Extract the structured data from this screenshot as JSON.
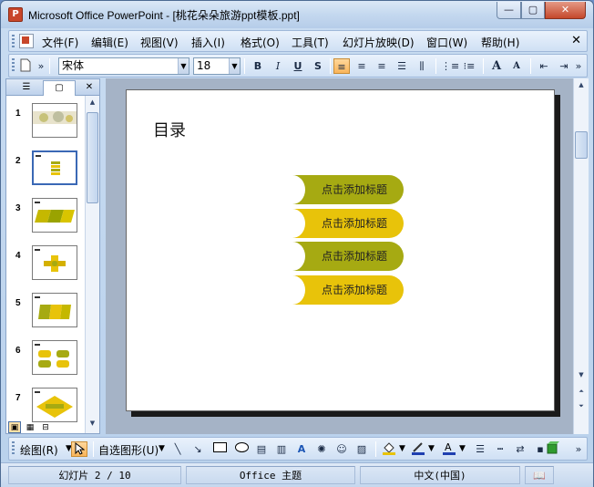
{
  "window": {
    "title": "Microsoft Office PowerPoint - [桃花朵朵旅游ppt模板.ppt]",
    "app_icon_glyph": "P",
    "minimize_glyph": "—",
    "maximize_glyph": "▢",
    "close_glyph": "✕"
  },
  "menu": {
    "items": [
      "文件(F)",
      "编辑(E)",
      "视图(V)",
      "插入(I)",
      "格式(O)",
      "工具(T)",
      "幻灯片放映(D)",
      "窗口(W)",
      "帮助(H)"
    ],
    "close_glyph": "✕"
  },
  "format_toolbar": {
    "font_name": "宋体",
    "font_size": "18",
    "bold": "B",
    "italic": "I",
    "underline": "U",
    "shadow": "S",
    "align_left": "≡",
    "align_center": "≡",
    "align_right": "≡",
    "font_grow": "A",
    "font_shrink": "A"
  },
  "left_panel": {
    "outline_tab_glyph": "☰",
    "slides_tab_glyph": "▢",
    "close_glyph": "✕",
    "thumbnails": [
      {
        "number": "1"
      },
      {
        "number": "2"
      },
      {
        "number": "3"
      },
      {
        "number": "4"
      },
      {
        "number": "5"
      },
      {
        "number": "6"
      },
      {
        "number": "7"
      }
    ],
    "selected_slide": 2,
    "view_buttons": [
      "▣",
      "▦",
      "⊟"
    ]
  },
  "slide": {
    "title": "目录",
    "items": [
      "点击添加标题",
      "点击添加标题",
      "点击添加标题",
      "点击添加标题"
    ],
    "colors": {
      "olive": "#a6aa12",
      "gold": "#e8c30a"
    }
  },
  "draw_toolbar": {
    "draw_label": "绘图(R)",
    "autoshapes_label": "自选图形(U)"
  },
  "status": {
    "slide_info": "幻灯片 2 / 10",
    "theme": "Office 主题",
    "language": "中文(中国)"
  }
}
